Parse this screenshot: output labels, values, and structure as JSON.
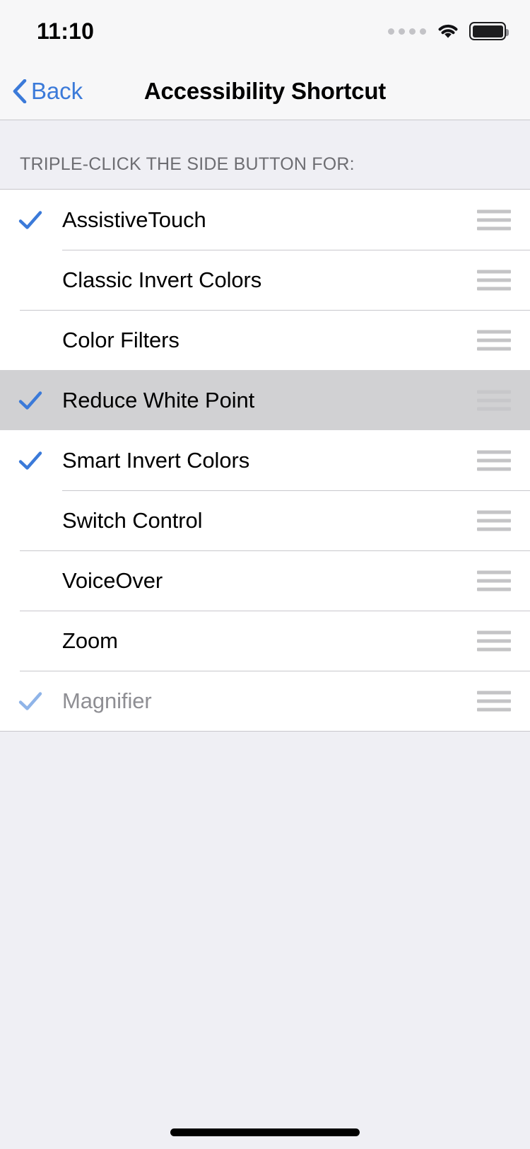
{
  "status_bar": {
    "time": "11:10",
    "signal_dots": 4,
    "wifi_icon": "wifi-icon",
    "battery_icon": "battery-full-icon",
    "battery_level": 100
  },
  "nav": {
    "back_label": "Back",
    "back_icon": "chevron-left-icon",
    "title": "Accessibility Shortcut"
  },
  "section": {
    "header": "TRIPLE-CLICK THE SIDE BUTTON FOR:"
  },
  "colors": {
    "accent_blue": "#3b7ad9",
    "accent_blue_disabled": "#8fb4e8",
    "separator": "#c8c7cc",
    "group_background": "#efeff4",
    "row_background": "#ffffff",
    "row_selected_background": "#d1d1d3",
    "handle_gray": "#c4c4c6",
    "disabled_text": "#8e8e93",
    "header_text": "#6d6d72"
  },
  "rows": [
    {
      "label": "AssistiveTouch",
      "checked": true,
      "selected": false,
      "disabled": false,
      "separator": "none",
      "handle": "reorder-handle-icon"
    },
    {
      "label": "Classic Invert Colors",
      "checked": false,
      "selected": false,
      "disabled": false,
      "separator": "inset",
      "handle": "reorder-handle-icon"
    },
    {
      "label": "Color Filters",
      "checked": false,
      "selected": false,
      "disabled": false,
      "separator": "full",
      "handle": "reorder-handle-icon"
    },
    {
      "label": "Reduce White Point",
      "checked": true,
      "selected": true,
      "disabled": false,
      "separator": "none",
      "handle": "reorder-handle-icon"
    },
    {
      "label": "Smart Invert Colors",
      "checked": true,
      "selected": false,
      "disabled": false,
      "separator": "none",
      "handle": "reorder-handle-icon"
    },
    {
      "label": "Switch Control",
      "checked": false,
      "selected": false,
      "disabled": false,
      "separator": "inset",
      "handle": "reorder-handle-icon"
    },
    {
      "label": "VoiceOver",
      "checked": false,
      "selected": false,
      "disabled": false,
      "separator": "full",
      "handle": "reorder-handle-icon"
    },
    {
      "label": "Zoom",
      "checked": false,
      "selected": false,
      "disabled": false,
      "separator": "full",
      "handle": "reorder-handle-icon"
    },
    {
      "label": "Magnifier",
      "checked": true,
      "selected": false,
      "disabled": true,
      "separator": "full",
      "handle": "reorder-handle-icon"
    }
  ],
  "home_indicator": "home-indicator"
}
